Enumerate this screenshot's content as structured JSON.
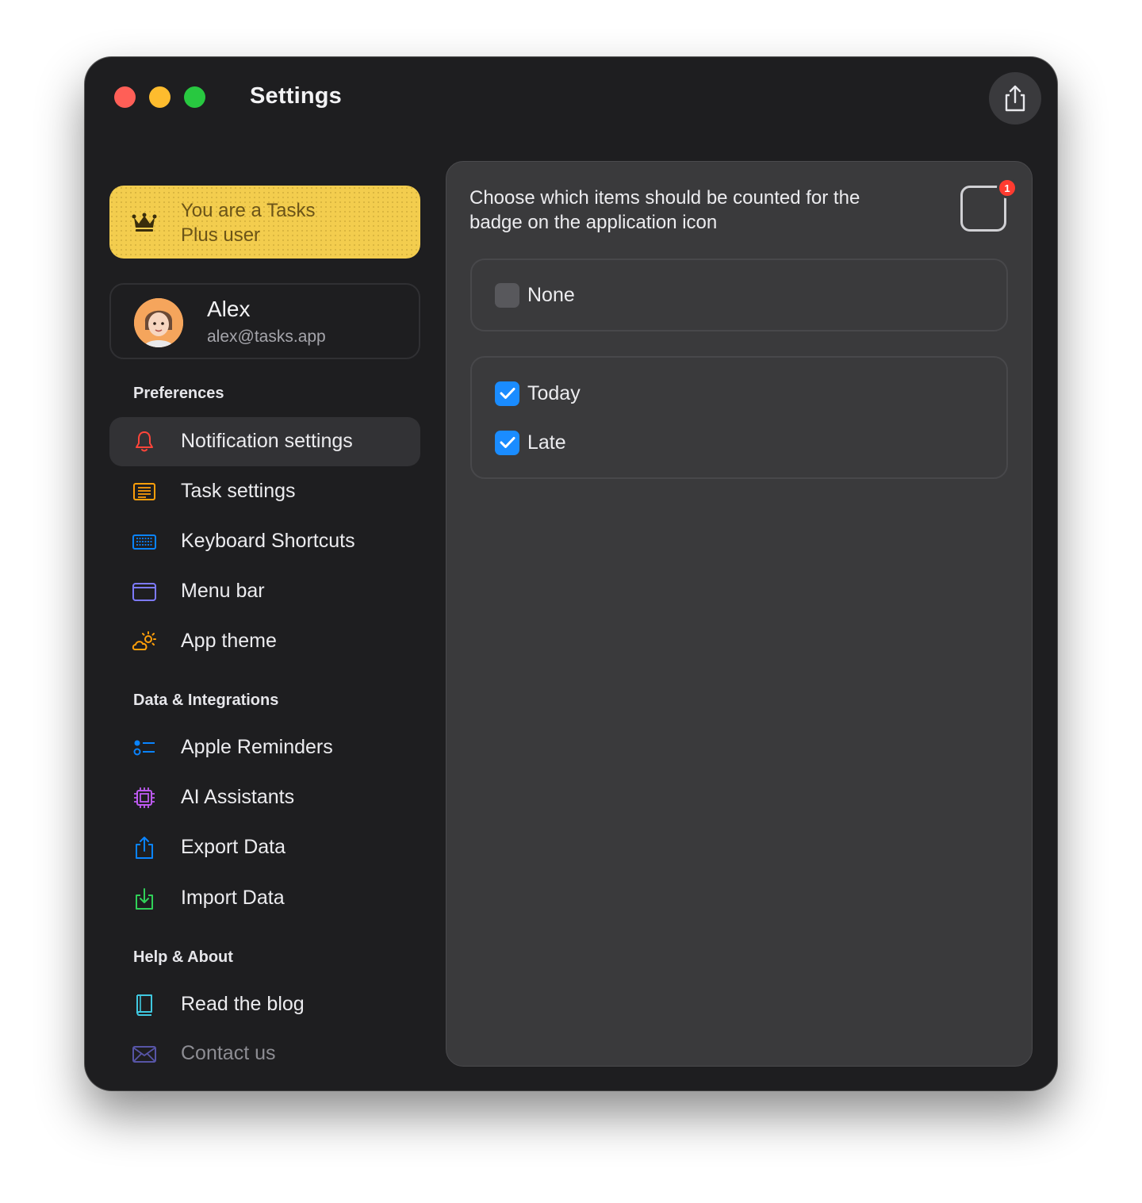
{
  "window": {
    "title": "Settings"
  },
  "colors": {
    "accent_blue": "#1a8cff",
    "plus_yellow": "#f3cd4e",
    "badge_red": "#ff3b30"
  },
  "promo": {
    "line1": "You are a Tasks",
    "line2": "Plus user",
    "icon": "crown-icon"
  },
  "user": {
    "name": "Alex",
    "email": "alex@tasks.app"
  },
  "sidebar": {
    "sections": [
      {
        "title": "Preferences",
        "items": [
          {
            "label": "Notification settings",
            "icon": "bell-icon",
            "color": "#ff453a",
            "active": true
          },
          {
            "label": "Task settings",
            "icon": "list-icon",
            "color": "#ff9f0a"
          },
          {
            "label": "Keyboard Shortcuts",
            "icon": "keyboard-icon",
            "color": "#0a84ff"
          },
          {
            "label": "Menu bar",
            "icon": "menubar-icon",
            "color": "#7d7aff"
          },
          {
            "label": "App theme",
            "icon": "sun-cloud-icon",
            "color": "#ff9f0a"
          }
        ]
      },
      {
        "title": "Data & Integrations",
        "items": [
          {
            "label": "Apple Reminders",
            "icon": "reminders-icon",
            "color": "#0a84ff"
          },
          {
            "label": "AI Assistants",
            "icon": "cpu-icon",
            "color": "#bf5af2"
          },
          {
            "label": "Export Data",
            "icon": "export-icon",
            "color": "#0a84ff"
          },
          {
            "label": "Import Data",
            "icon": "import-icon",
            "color": "#30d158"
          }
        ]
      },
      {
        "title": "Help & About",
        "items": [
          {
            "label": "Read the blog",
            "icon": "book-icon",
            "color": "#40c8e0"
          },
          {
            "label": "Contact us",
            "icon": "envelope-icon",
            "color": "#7d7aff"
          }
        ]
      }
    ]
  },
  "panel": {
    "description": "Choose which items should be counted for the badge on the application icon",
    "badge_count": "1",
    "options_none": {
      "label": "None",
      "checked": false
    },
    "options": [
      {
        "label": "Today",
        "checked": true
      },
      {
        "label": "Late",
        "checked": true
      }
    ]
  }
}
